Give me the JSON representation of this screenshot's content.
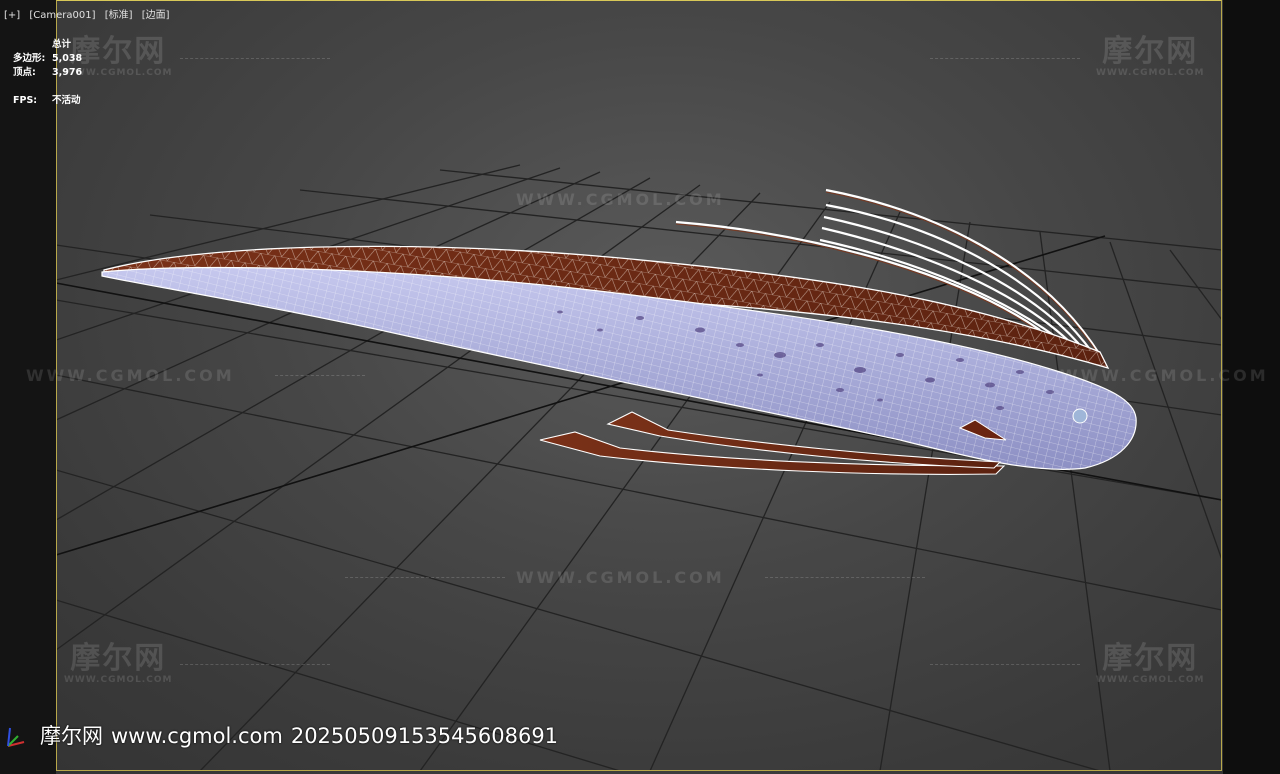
{
  "viewport": {
    "labels": [
      "[+]",
      "[Camera001]",
      "[标准]",
      "[边面]"
    ]
  },
  "stats": {
    "header": "总计",
    "polygons_label": "多边形:",
    "polygons_value": "5,038",
    "vertices_label": "顶点:",
    "vertices_value": "3,976",
    "fps_label": "FPS:",
    "fps_value": "不活动"
  },
  "watermark": {
    "logo_cn": "摩尔网",
    "logo_en": "WWW.CGMOL.COM",
    "url": "WWW.CGMOL.COM"
  },
  "footer": {
    "site_name": "摩尔网",
    "url": "www.cgmol.com",
    "id": "20250509153545608691"
  },
  "colors": {
    "frame": "#d8c858",
    "grid": "#222222",
    "body": "#a7abd9",
    "fin": "#6e2a14",
    "wire": "#ffffff"
  },
  "icons": {
    "axis": "xyz-axis-gizmo"
  }
}
